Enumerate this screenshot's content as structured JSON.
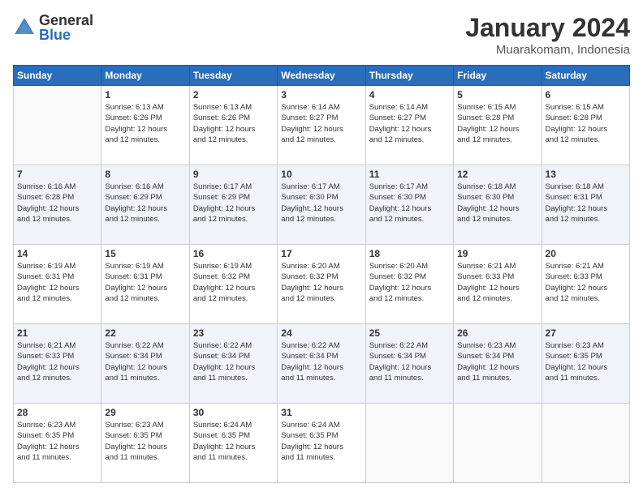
{
  "header": {
    "logo_general": "General",
    "logo_blue": "Blue",
    "month_title": "January 2024",
    "location": "Muarakomam, Indonesia"
  },
  "days_of_week": [
    "Sunday",
    "Monday",
    "Tuesday",
    "Wednesday",
    "Thursday",
    "Friday",
    "Saturday"
  ],
  "weeks": [
    [
      {
        "day": "",
        "info": ""
      },
      {
        "day": "1",
        "info": "Sunrise: 6:13 AM\nSunset: 6:26 PM\nDaylight: 12 hours\nand 12 minutes."
      },
      {
        "day": "2",
        "info": "Sunrise: 6:13 AM\nSunset: 6:26 PM\nDaylight: 12 hours\nand 12 minutes."
      },
      {
        "day": "3",
        "info": "Sunrise: 6:14 AM\nSunset: 6:27 PM\nDaylight: 12 hours\nand 12 minutes."
      },
      {
        "day": "4",
        "info": "Sunrise: 6:14 AM\nSunset: 6:27 PM\nDaylight: 12 hours\nand 12 minutes."
      },
      {
        "day": "5",
        "info": "Sunrise: 6:15 AM\nSunset: 6:28 PM\nDaylight: 12 hours\nand 12 minutes."
      },
      {
        "day": "6",
        "info": "Sunrise: 6:15 AM\nSunset: 6:28 PM\nDaylight: 12 hours\nand 12 minutes."
      }
    ],
    [
      {
        "day": "7",
        "info": "Sunrise: 6:16 AM\nSunset: 6:28 PM\nDaylight: 12 hours\nand 12 minutes."
      },
      {
        "day": "8",
        "info": "Sunrise: 6:16 AM\nSunset: 6:29 PM\nDaylight: 12 hours\nand 12 minutes."
      },
      {
        "day": "9",
        "info": "Sunrise: 6:17 AM\nSunset: 6:29 PM\nDaylight: 12 hours\nand 12 minutes."
      },
      {
        "day": "10",
        "info": "Sunrise: 6:17 AM\nSunset: 6:30 PM\nDaylight: 12 hours\nand 12 minutes."
      },
      {
        "day": "11",
        "info": "Sunrise: 6:17 AM\nSunset: 6:30 PM\nDaylight: 12 hours\nand 12 minutes."
      },
      {
        "day": "12",
        "info": "Sunrise: 6:18 AM\nSunset: 6:30 PM\nDaylight: 12 hours\nand 12 minutes."
      },
      {
        "day": "13",
        "info": "Sunrise: 6:18 AM\nSunset: 6:31 PM\nDaylight: 12 hours\nand 12 minutes."
      }
    ],
    [
      {
        "day": "14",
        "info": "Sunrise: 6:19 AM\nSunset: 6:31 PM\nDaylight: 12 hours\nand 12 minutes."
      },
      {
        "day": "15",
        "info": "Sunrise: 6:19 AM\nSunset: 6:31 PM\nDaylight: 12 hours\nand 12 minutes."
      },
      {
        "day": "16",
        "info": "Sunrise: 6:19 AM\nSunset: 6:32 PM\nDaylight: 12 hours\nand 12 minutes."
      },
      {
        "day": "17",
        "info": "Sunrise: 6:20 AM\nSunset: 6:32 PM\nDaylight: 12 hours\nand 12 minutes."
      },
      {
        "day": "18",
        "info": "Sunrise: 6:20 AM\nSunset: 6:32 PM\nDaylight: 12 hours\nand 12 minutes."
      },
      {
        "day": "19",
        "info": "Sunrise: 6:21 AM\nSunset: 6:33 PM\nDaylight: 12 hours\nand 12 minutes."
      },
      {
        "day": "20",
        "info": "Sunrise: 6:21 AM\nSunset: 6:33 PM\nDaylight: 12 hours\nand 12 minutes."
      }
    ],
    [
      {
        "day": "21",
        "info": "Sunrise: 6:21 AM\nSunset: 6:33 PM\nDaylight: 12 hours\nand 12 minutes."
      },
      {
        "day": "22",
        "info": "Sunrise: 6:22 AM\nSunset: 6:34 PM\nDaylight: 12 hours\nand 11 minutes."
      },
      {
        "day": "23",
        "info": "Sunrise: 6:22 AM\nSunset: 6:34 PM\nDaylight: 12 hours\nand 11 minutes."
      },
      {
        "day": "24",
        "info": "Sunrise: 6:22 AM\nSunset: 6:34 PM\nDaylight: 12 hours\nand 11 minutes."
      },
      {
        "day": "25",
        "info": "Sunrise: 6:22 AM\nSunset: 6:34 PM\nDaylight: 12 hours\nand 11 minutes."
      },
      {
        "day": "26",
        "info": "Sunrise: 6:23 AM\nSunset: 6:34 PM\nDaylight: 12 hours\nand 11 minutes."
      },
      {
        "day": "27",
        "info": "Sunrise: 6:23 AM\nSunset: 6:35 PM\nDaylight: 12 hours\nand 11 minutes."
      }
    ],
    [
      {
        "day": "28",
        "info": "Sunrise: 6:23 AM\nSunset: 6:35 PM\nDaylight: 12 hours\nand 11 minutes."
      },
      {
        "day": "29",
        "info": "Sunrise: 6:23 AM\nSunset: 6:35 PM\nDaylight: 12 hours\nand 11 minutes."
      },
      {
        "day": "30",
        "info": "Sunrise: 6:24 AM\nSunset: 6:35 PM\nDaylight: 12 hours\nand 11 minutes."
      },
      {
        "day": "31",
        "info": "Sunrise: 6:24 AM\nSunset: 6:35 PM\nDaylight: 12 hours\nand 11 minutes."
      },
      {
        "day": "",
        "info": ""
      },
      {
        "day": "",
        "info": ""
      },
      {
        "day": "",
        "info": ""
      }
    ]
  ]
}
